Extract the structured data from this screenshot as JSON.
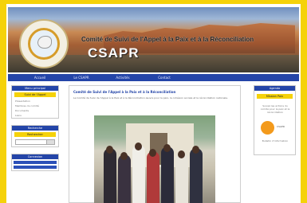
{
  "site": {
    "title": "Comité de Suivi de l'Appel à la Paix et à la Réconciliation",
    "abbr": "CSAPR"
  },
  "nav": {
    "items": [
      "Accueil",
      "Le CSAPR",
      "Activités",
      "Contact"
    ]
  },
  "left": {
    "menu_head": "Menu principal",
    "menu_sub": "Suivi de l'Appel",
    "menu_items": [
      "Présentation",
      "Membres du comité",
      "Documents",
      "Liens"
    ],
    "search_head": "Recherche",
    "search_sub": "Rechercher",
    "search_placeholder": "",
    "bottom_head": "Connexion",
    "bottom_items": [
      "Identifiant",
      "Mot de passe"
    ]
  },
  "main": {
    "title": "Comité de Suivi de l'Appel à la Paix et à la Réconciliation",
    "intro": "Le Comité de Suivi de l'Appel à la Paix et à la Réconciliation œuvre pour la paix, la cohésion sociale et la réconciliation nationale."
  },
  "right": {
    "head": "Agenda",
    "sub": "Mission Paix",
    "text": "Suivez les actions du comité pour la paix et la réconciliation",
    "badge_label": "CSAPR",
    "foot": "Bulletin d'information"
  },
  "colors": {
    "page_bg": "#f5d20a",
    "nav_bg": "#2445a8",
    "accent_orange": "#f39a1c"
  }
}
